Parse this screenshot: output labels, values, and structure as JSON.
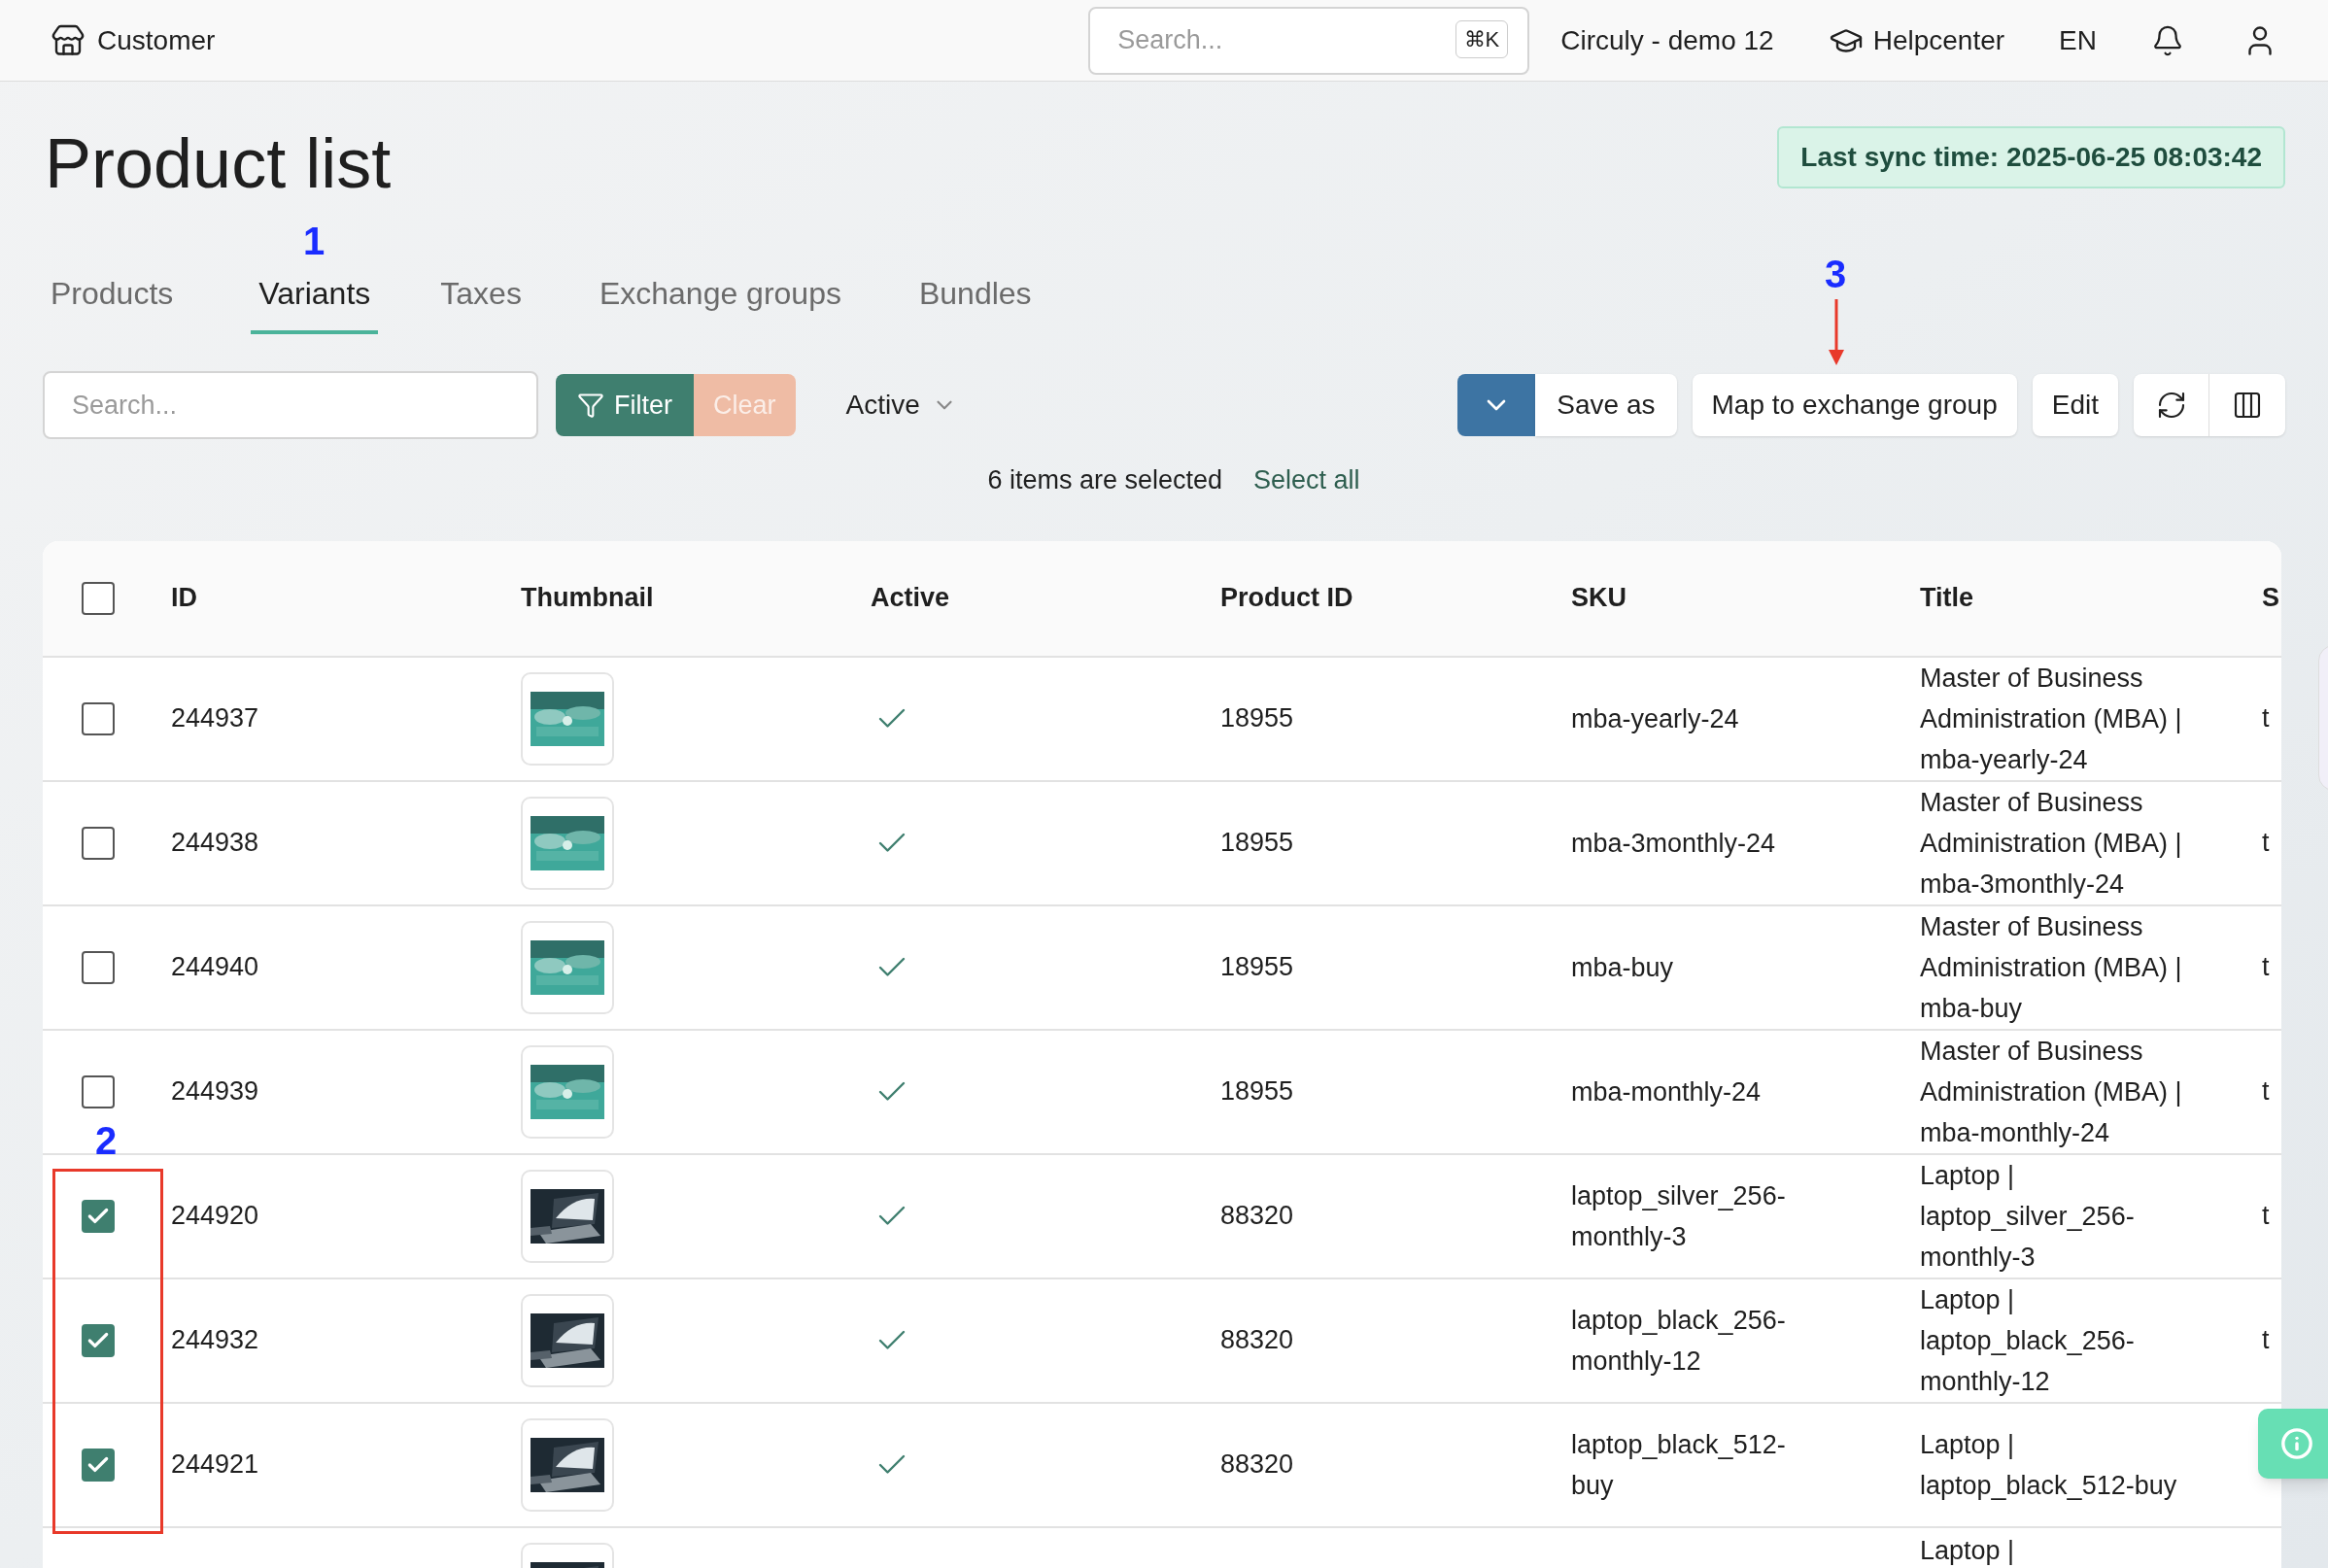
{
  "topbar": {
    "brand": "Customer",
    "search": {
      "placeholder": "Search...",
      "shortcut": "⌘K"
    },
    "workspace": "Circuly - demo 12",
    "help": "Helpcenter",
    "language": "EN"
  },
  "page": {
    "title": "Product list",
    "sync": "Last sync time: 2025-06-25 08:03:42"
  },
  "tabs": [
    {
      "label": "Products",
      "selected": false
    },
    {
      "label": "Variants",
      "selected": true
    },
    {
      "label": "Taxes",
      "selected": false
    },
    {
      "label": "Exchange groups",
      "selected": false
    },
    {
      "label": "Bundles",
      "selected": false
    }
  ],
  "toolbar": {
    "search": {
      "placeholder": "Search..."
    },
    "filter": "Filter",
    "clear": "Clear",
    "status": "Active",
    "save_as": "Save as",
    "map": "Map to exchange group",
    "edit": "Edit"
  },
  "selection": {
    "text": "6 items are selected",
    "select_all": "Select all"
  },
  "table": {
    "header_checked": false,
    "columns": [
      "ID",
      "Thumbnail",
      "Active",
      "Product ID",
      "SKU",
      "Title",
      "S"
    ],
    "rows": [
      {
        "selected": false,
        "id": "244937",
        "active": true,
        "product_id": "18955",
        "sku": "mba-yearly-24",
        "title": "Master of Business Administration (MBA) | mba-yearly-24",
        "column_8": "t"
      },
      {
        "selected": false,
        "id": "244938",
        "active": true,
        "product_id": "18955",
        "sku": "mba-3monthly-24",
        "title": "Master of Business Administration (MBA) | mba-3monthly-24",
        "column_8": "t"
      },
      {
        "selected": false,
        "id": "244940",
        "active": true,
        "product_id": "18955",
        "sku": "mba-buy",
        "title": "Master of Business Administration (MBA) | mba-buy",
        "column_8": "t"
      },
      {
        "selected": false,
        "id": "244939",
        "active": true,
        "product_id": "18955",
        "sku": "mba-monthly-24",
        "title": "Master of Business Administration (MBA) | mba-monthly-24",
        "column_8": "t"
      },
      {
        "selected": true,
        "id": "244920",
        "active": true,
        "product_id": "88320",
        "sku": "laptop_silver_256-monthly-3",
        "title": "Laptop | laptop_silver_256-monthly-3",
        "column_8": "t"
      },
      {
        "selected": true,
        "id": "244932",
        "active": true,
        "product_id": "88320",
        "sku": "laptop_black_256-monthly-12",
        "title": "Laptop | laptop_black_256-monthly-12",
        "column_8": "t"
      },
      {
        "selected": true,
        "id": "244921",
        "active": true,
        "product_id": "88320",
        "sku": "laptop_black_512-buy",
        "title": "Laptop | laptop_black_512-buy"
      },
      {
        "title": "Laptop |"
      }
    ]
  },
  "callouts": [
    {
      "label": "1"
    },
    {
      "label": "2"
    },
    {
      "label": "3"
    }
  ]
}
